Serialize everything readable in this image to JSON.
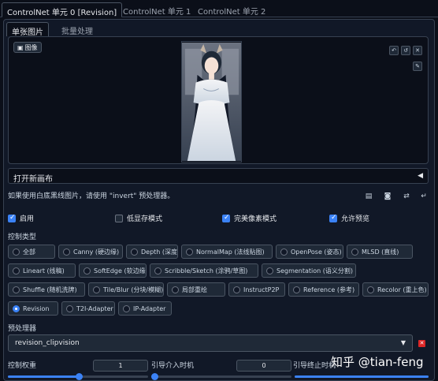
{
  "tabs": [
    "ControlNet 单元 0 [Revision]",
    "ControlNet 单元 1",
    "ControlNet 单元 2"
  ],
  "subtabs": [
    "单张图片",
    "批量处理"
  ],
  "image_label": "图像",
  "canvas_button": "打开新画布",
  "hint": "如果使用白底黑线图片，请使用 \"invert\" 预处理器。",
  "checkboxes": [
    {
      "label": "启用",
      "checked": true
    },
    {
      "label": "低显存模式",
      "checked": false
    },
    {
      "label": "完美像素模式",
      "checked": true
    },
    {
      "label": "允许预览",
      "checked": true
    }
  ],
  "control_type_label": "控制类型",
  "control_types": [
    "全部",
    "Canny (硬边缘)",
    "Depth (深度)",
    "NormalMap (法线贴图)",
    "OpenPose (姿态)",
    "MLSD (直线)",
    "Lineart (线稿)",
    "SoftEdge (软边缘)",
    "Scribble/Sketch (涂鸦/草图)",
    "Segmentation (语义分割)",
    "Shuffle (随机洗牌)",
    "Tile/Blur (分块/模糊)",
    "局部重绘",
    "InstructP2P",
    "Reference (参考)",
    "Recolor (重上色)",
    "Revision",
    "T2I-Adapter",
    "IP-Adapter"
  ],
  "selected_type": "Revision",
  "preprocessor_label": "预处理器",
  "preprocessor_value": "revision_clipvision",
  "control_weight_label": "控制权重",
  "control_weight_value": "1",
  "start_label": "引导介入时机",
  "start_value": "0",
  "end_label": "引导终止时机",
  "watermark": "知乎 @tian-feng",
  "colors": {
    "accent": "#3b82f6",
    "bg": "#0b0f19",
    "panel": "#111827"
  }
}
